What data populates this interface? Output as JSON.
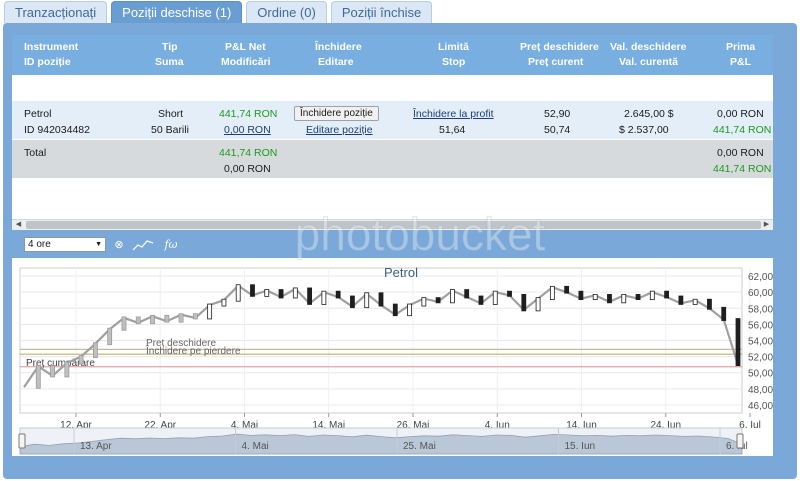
{
  "tabs": [
    {
      "label": "Tranzacționați",
      "active": false
    },
    {
      "label": "Poziții deschise (1)",
      "active": true
    },
    {
      "label": "Ordine (0)",
      "active": false
    },
    {
      "label": "Poziții închise",
      "active": false
    }
  ],
  "table": {
    "headers": {
      "instrument": "Instrument",
      "id": "ID poziție",
      "tip": "Tip",
      "suma": "Suma",
      "pl_net": "P&L Net",
      "modificari": "Modificări",
      "inchidere": "Închidere",
      "editare": "Editare",
      "limita": "Limită",
      "stop": "Stop",
      "pret_deschidere": "Preț deschidere",
      "pret_curent": "Preț curent",
      "val_deschidere": "Val. deschidere",
      "val_curenta": "Val. curentă",
      "prima": "Prima",
      "prima_pl": "P&L"
    },
    "position": {
      "instrument": "Petrol",
      "id": "ID 942034482",
      "tip": "Short",
      "suma": "50 Barili",
      "pl_net": "441,74 RON",
      "modificari": "0,00 RON",
      "close_button": "Închidere poziție",
      "edit_link": "Editare poziție",
      "limit_link": "Închidere la profit",
      "stop": "51,64",
      "pret_deschidere": "52,90",
      "pret_curent": "50,74",
      "val_deschidere": "2.645,00 $",
      "val_curenta": "$ 2.537,00",
      "prima": "0,00 RON",
      "prima_pl": "441,74 RON"
    },
    "total": {
      "label": "Total",
      "pl_net": "441,74 RON",
      "modificari": "0,00 RON",
      "prima": "0,00 RON",
      "prima_pl": "441,74 RON"
    }
  },
  "chart_toolbar": {
    "interval": "4 ore",
    "icons": [
      "zoom-reset-icon",
      "line-chart-icon",
      "indicator-fx-icon"
    ]
  },
  "chart_data": {
    "type": "line",
    "title": "Petrol",
    "ylim": [
      45,
      63
    ],
    "y_ticks": [
      "62,00",
      "60,00",
      "58,00",
      "56,00",
      "54,00",
      "52,00",
      "50,00",
      "48,00",
      "46,00"
    ],
    "y_tick_values": [
      62,
      60,
      58,
      56,
      54,
      52,
      50,
      48,
      46
    ],
    "x_ticks": [
      "12. Apr",
      "22. Apr",
      "4. Mai",
      "14. Mai",
      "26. Mai",
      "4. Iun",
      "14. Iun",
      "24. Iun",
      "6. Iul"
    ],
    "navigator_ticks": [
      "13. Apr",
      "4. Mai",
      "25. Mai",
      "15. Iun",
      "6. Iul"
    ],
    "annotations": [
      {
        "label": "Preț deschidere",
        "value": 52.9,
        "color": "#c9b8a0"
      },
      {
        "label": "Închidere pe pierdere",
        "value": 52.3,
        "color": "#b9b36a"
      },
      {
        "label": "Preț cumpărare",
        "value": 50.74,
        "color": "#e8a0a0"
      }
    ],
    "grid": true,
    "series": [
      {
        "name": "",
        "x": [
          0,
          2,
          4,
          6,
          8,
          10,
          12,
          14,
          16,
          18,
          20,
          22,
          24,
          26,
          28,
          30,
          32,
          34,
          36,
          38,
          40,
          42,
          44,
          46,
          48,
          50,
          52,
          54,
          56,
          58,
          60,
          62,
          64,
          66,
          68,
          70,
          72,
          74,
          76,
          78,
          80,
          82,
          84,
          86,
          88,
          90,
          92,
          94,
          96,
          98,
          100
        ],
        "values": [
          48.2,
          50.8,
          49.6,
          51.2,
          52.0,
          53.6,
          55.4,
          56.8,
          56.2,
          57.0,
          56.4,
          57.2,
          56.8,
          58.4,
          59.0,
          60.8,
          59.6,
          60.2,
          59.4,
          60.4,
          58.6,
          60.0,
          59.4,
          58.2,
          59.8,
          58.4,
          57.2,
          58.4,
          59.2,
          58.8,
          60.2,
          59.4,
          58.6,
          60.0,
          59.6,
          57.8,
          59.2,
          60.6,
          60.0,
          59.2,
          59.6,
          58.8,
          59.6,
          59.2,
          60.0,
          59.4,
          58.6,
          59.0,
          58.0,
          56.6,
          51.0
        ]
      }
    ]
  }
}
